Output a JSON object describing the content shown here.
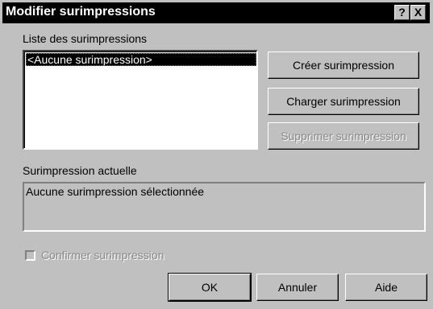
{
  "window": {
    "title": "Modifier surimpressions",
    "help_btn": "?",
    "close_btn": "X"
  },
  "overlays_list": {
    "label": "Liste des surimpressions",
    "items": [
      "<Aucune surimpression>"
    ],
    "selected_index": 0
  },
  "buttons": {
    "create": "Créer surimpression",
    "load": "Charger surimpression",
    "delete": "Supprimer surimpression",
    "ok": "OK",
    "cancel": "Annuler",
    "help": "Aide"
  },
  "current_overlay": {
    "label": "Surimpression actuelle",
    "value": "Aucune surimpression sélectionnée"
  },
  "confirm_checkbox": {
    "label": "Confirmer surimpression",
    "checked": false,
    "enabled": false
  }
}
